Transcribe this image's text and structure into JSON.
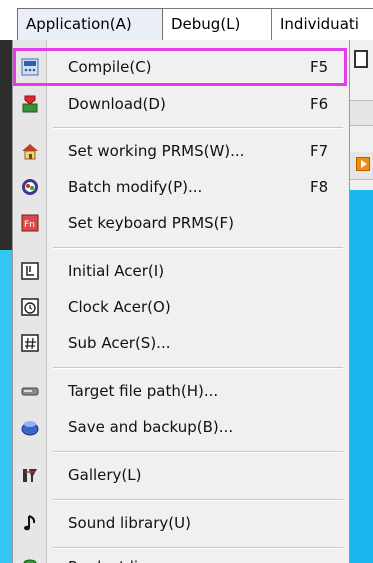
{
  "menubar": {
    "items": [
      {
        "label": "Application(A)"
      },
      {
        "label": "Debug(L)"
      },
      {
        "label": "Individuati"
      }
    ]
  },
  "menu": {
    "items": [
      {
        "label": "Compile(C)",
        "shortcut": "F5",
        "icon": "compile-icon",
        "highlighted": true
      },
      {
        "label": "Download(D)",
        "shortcut": "F6",
        "icon": "download-icon"
      },
      {
        "label": "Set working PRMS(W)...",
        "shortcut": "F7",
        "icon": "house-icon"
      },
      {
        "label": "Batch modify(P)...",
        "shortcut": "F8",
        "icon": "batch-icon"
      },
      {
        "label": "Set keyboard PRMS(F)",
        "shortcut": "",
        "icon": "keyboard-fn-icon"
      },
      {
        "label": "Initial Acer(I)",
        "shortcut": "",
        "icon": "initial-icon"
      },
      {
        "label": "Clock Acer(O)",
        "shortcut": "",
        "icon": "clock-icon"
      },
      {
        "label": "Sub Acer(S)...",
        "shortcut": "",
        "icon": "hash-icon"
      },
      {
        "label": "Target file path(H)...",
        "shortcut": "",
        "icon": "drive-icon"
      },
      {
        "label": "Save and backup(B)...",
        "shortcut": "",
        "icon": "backup-icon"
      },
      {
        "label": "Gallery(L)",
        "shortcut": "",
        "icon": "gallery-icon"
      },
      {
        "label": "Sound library(U)",
        "shortcut": "",
        "icon": "music-note-icon"
      },
      {
        "label": "Product license",
        "shortcut": "",
        "icon": "license-icon"
      }
    ]
  },
  "colors": {
    "highlight_border": "#e23de8",
    "background_cyan": "#1ab7ee"
  }
}
